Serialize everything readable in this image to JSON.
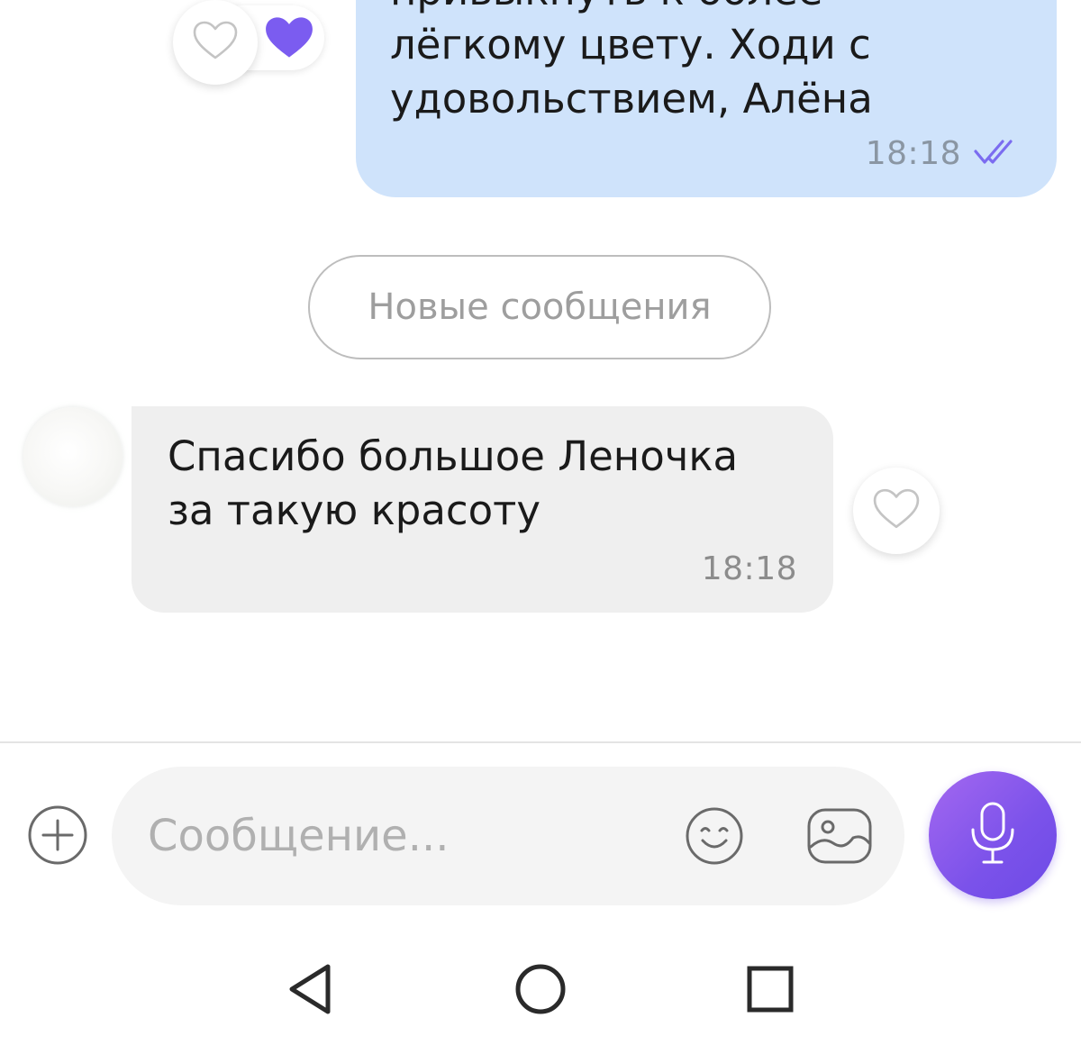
{
  "colors": {
    "outgoing_bubble": "#cfe3fb",
    "incoming_bubble": "#efefef",
    "accent_purple": "#7b52ea",
    "read_ticks": "#7b6cf0",
    "reaction_heart_filled": "#7b5cf0"
  },
  "outgoing_message": {
    "text": "привыкнуть к более\nлёгкому цвету.  Ходи с\nудовольствием, Алёна",
    "time": "18:18",
    "status_icon": "double-check-icon",
    "reactions": [
      "heart-outline-icon",
      "heart-filled-icon"
    ]
  },
  "divider": {
    "label": "Новые сообщения"
  },
  "incoming_message": {
    "text": "Спасибо большое Леночка\nза такую красоту",
    "time": "18:18",
    "reaction_button_icon": "heart-outline-icon"
  },
  "composer": {
    "placeholder": "Сообщение...",
    "attach_icon": "plus-circle-icon",
    "emoji_icon": "smiley-icon",
    "gallery_icon": "image-icon",
    "send_icon": "microphone-icon"
  },
  "system_nav": {
    "back_icon": "back-triangle-icon",
    "home_icon": "home-circle-icon",
    "recents_icon": "recents-square-icon"
  }
}
